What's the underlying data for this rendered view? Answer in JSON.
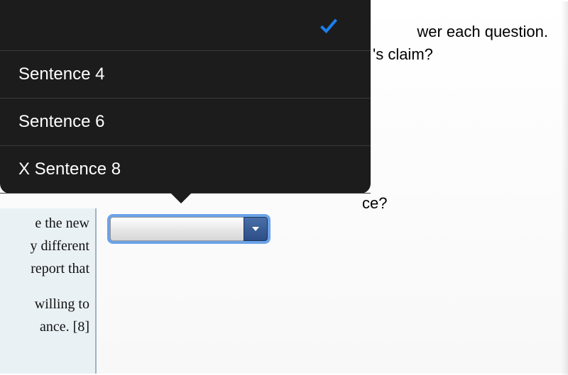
{
  "background": {
    "top_text_1": "wer each question.",
    "top_text_2": "'s claim?",
    "question_fragment": "ce?",
    "left_panel": {
      "line1": "e the new",
      "line2": "y different",
      "line3": "report that",
      "line4": "willing to",
      "line5": "ance. [8]"
    }
  },
  "dropdown": {
    "items": [
      {
        "label": "",
        "selected": true
      },
      {
        "label": "Sentence 4",
        "selected": false
      },
      {
        "label": "Sentence 6",
        "selected": false
      },
      {
        "label": "X Sentence 8",
        "selected": false
      }
    ]
  },
  "select": {
    "value": ""
  }
}
